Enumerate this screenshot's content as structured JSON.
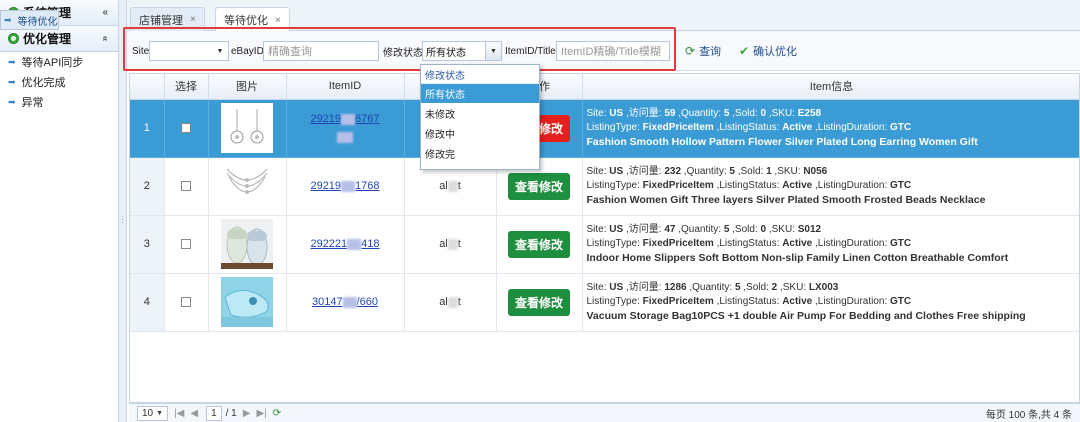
{
  "sidebar": {
    "sections": [
      {
        "title": "系统管理",
        "chevron": "«"
      },
      {
        "title": "优化管理",
        "chevron": "«"
      }
    ],
    "items": [
      {
        "label": "等待优化",
        "selected": true
      },
      {
        "label": "等待API同步",
        "selected": false
      },
      {
        "label": "优化完成",
        "selected": false
      },
      {
        "label": "异常",
        "selected": false
      }
    ]
  },
  "tabs": [
    {
      "label": "店铺管理",
      "close": "×",
      "active": false
    },
    {
      "label": "等待优化",
      "close": "×",
      "active": true
    }
  ],
  "toolbar": {
    "site_label": "Site",
    "site_value": "",
    "ebayid_label": "eBayID",
    "ebayid_placeholder": "精确查询",
    "status_label": "修改状态",
    "status_value": "所有状态",
    "itemid_label": "ItemID/Title",
    "itemid_placeholder": "ItemID精确/Title模糊",
    "query_label": "查询",
    "confirm_label": "确认优化",
    "highlight_color": "#e03a3a"
  },
  "status_dropdown": {
    "header": "修改状态",
    "options": [
      "所有状态",
      "未修改",
      "修改中",
      "修改完"
    ],
    "highlighted": "所有状态"
  },
  "grid": {
    "columns": [
      "",
      "选择",
      "图片",
      "ItemID",
      "",
      "操作",
      "Item信息"
    ],
    "rows": [
      {
        "n": "1",
        "selected": true,
        "itemid_a": "29219",
        "itemid_b": "6767",
        "account_a": "",
        "account_b": "",
        "action": "查看修改",
        "action_color": "#e6201c",
        "site": "US",
        "views": "59",
        "qty": "5",
        "sold": "0",
        "sku": "E258",
        "listing_type": "FixedPriceItem",
        "status": "Active",
        "duration": "GTC",
        "title": "Fashion Smooth Hollow Pattern Flower Silver Plated Long Earring Women Gift"
      },
      {
        "n": "2",
        "selected": false,
        "itemid_a": "29219",
        "itemid_b": "1768",
        "account_a": "al",
        "account_b": "t",
        "action": "查看修改",
        "action_color": "#1e8f3e",
        "site": "US",
        "views": "232",
        "qty": "5",
        "sold": "1",
        "sku": "N056",
        "listing_type": "FixedPriceItem",
        "status": "Active",
        "duration": "GTC",
        "title": "Fashion Women Gift Three layers Silver Plated Smooth Frosted Beads Necklace"
      },
      {
        "n": "3",
        "selected": false,
        "itemid_a": "292221",
        "itemid_b": "418",
        "account_a": "al",
        "account_b": "t",
        "action": "查看修改",
        "action_color": "#1e8f3e",
        "site": "US",
        "views": "47",
        "qty": "5",
        "sold": "0",
        "sku": "S012",
        "listing_type": "FixedPriceItem",
        "status": "Active",
        "duration": "GTC",
        "title": "Indoor Home Slippers Soft Bottom Non-slip Family Linen Cotton Breathable Comfort"
      },
      {
        "n": "4",
        "selected": false,
        "itemid_a": "30147",
        "itemid_b": "/660",
        "account_a": "al",
        "account_b": "t",
        "action": "查看修改",
        "action_color": "#1e8f3e",
        "site": "US",
        "views": "1286",
        "qty": "5",
        "sold": "2",
        "sku": "LX003",
        "listing_type": "FixedPriceItem",
        "status": "Active",
        "duration": "GTC",
        "title": "Vacuum Storage Bag10PCS +1 double Air Pump For Bedding and Clothes Free shipping"
      }
    ],
    "labels": {
      "site": "Site: ",
      "views": " ,访问量: ",
      "qty": " ,Quantity: ",
      "sold": " ,Sold: ",
      "sku": " ,SKU: ",
      "lt": "ListingType: ",
      "ls": " ,ListingStatus: ",
      "ld": " ,ListingDuration: "
    }
  },
  "pager": {
    "page_size": "10",
    "page": "1",
    "of": "/ 1",
    "summary": "每页 100 条,共 4 条"
  }
}
